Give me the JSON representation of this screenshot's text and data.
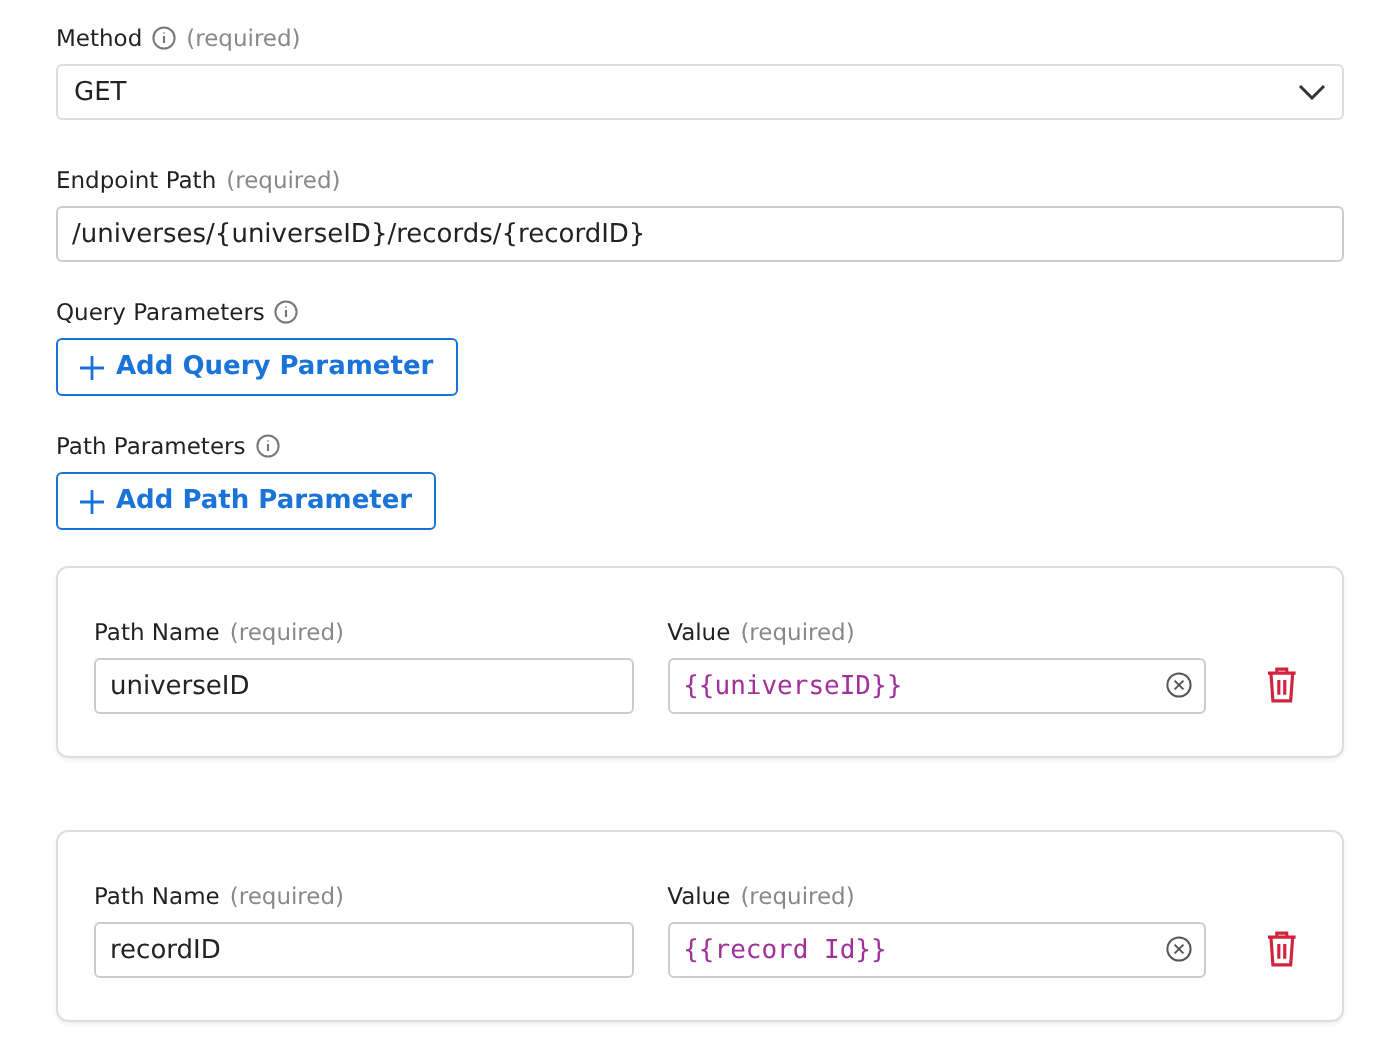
{
  "method": {
    "label": "Method",
    "hint": "(required)",
    "value": "GET"
  },
  "endpoint": {
    "label": "Endpoint Path",
    "hint": "(required)",
    "value": "/universes/{universeID}/records/{recordID}"
  },
  "query": {
    "label": "Query Parameters",
    "button": "Add Query Parameter"
  },
  "path": {
    "label": "Path Parameters",
    "button": "Add Path Parameter"
  },
  "params": [
    {
      "name_label": "Path Name",
      "name_hint": "(required)",
      "name": "universeID",
      "value_label": "Value",
      "value_hint": "(required)",
      "value": "{{universeID}}"
    },
    {
      "name_label": "Path Name",
      "name_hint": "(required)",
      "name": "recordID",
      "value_label": "Value",
      "value_hint": "(required)",
      "value": "{{record Id}}"
    }
  ]
}
